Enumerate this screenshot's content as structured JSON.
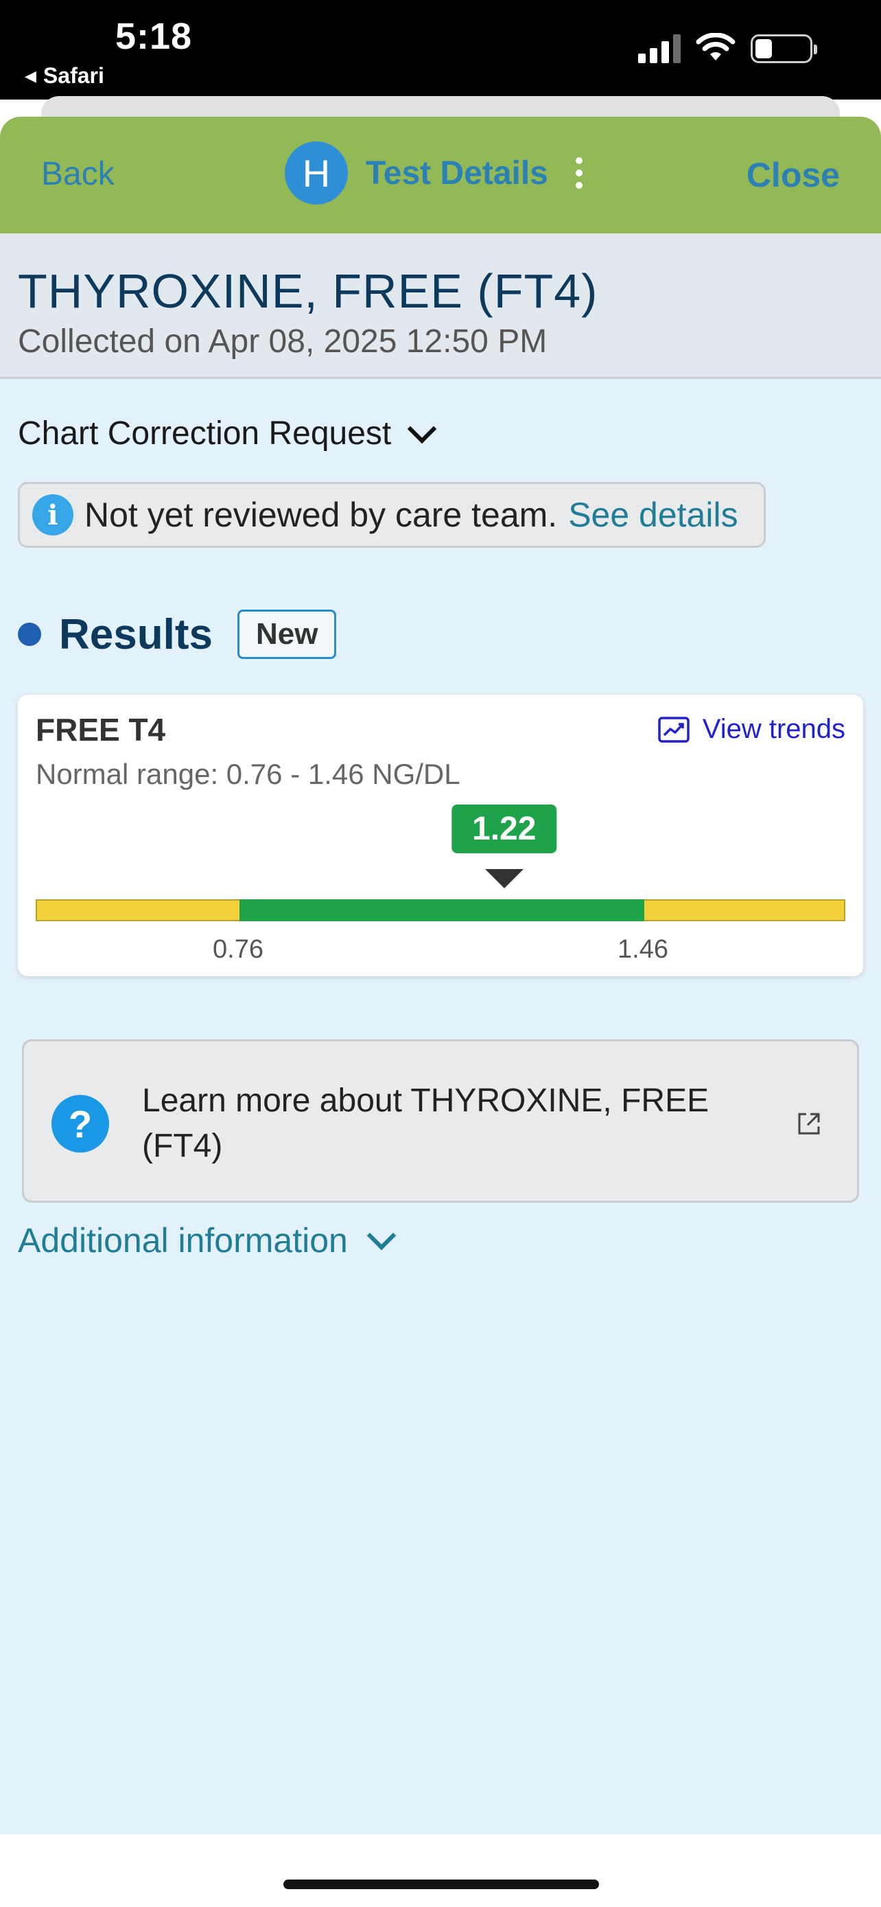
{
  "status_bar": {
    "time": "5:18",
    "back_app": "Safari",
    "signal_bars": 4,
    "signal_bars_active": 3,
    "battery_level": 0.32
  },
  "navbar": {
    "back_label": "Back",
    "avatar_letter": "H",
    "title": "Test Details",
    "close_label": "Close"
  },
  "header": {
    "test_name": "THYROXINE, FREE (FT4)",
    "collected": "Collected on Apr 08, 2025 12:50 PM"
  },
  "chart_correction": {
    "label": "Chart Correction Request"
  },
  "notice": {
    "text": "Not yet reviewed by care team.",
    "link": "See details"
  },
  "results": {
    "label": "Results",
    "badge": "New"
  },
  "result_card": {
    "component": "FREE T4",
    "view_trends": "View trends",
    "normal_range_text": "Normal range: 0.76 - 1.46 NG/DL",
    "value_label": "1.22",
    "value": 1.22,
    "low": 0.76,
    "high": 1.46,
    "low_label": "0.76",
    "high_label": "1.46"
  },
  "learn_more": {
    "text": "Learn more about THYROXINE, FREE (FT4)"
  },
  "additional_info": {
    "label": "Additional information"
  },
  "colors": {
    "navbar_bg": "#92b955",
    "link_blue": "#2b81b5",
    "normal_green": "#1fa34a",
    "out_of_range_yellow": "#f2d13c",
    "content_bg": "#e3f1fa"
  }
}
